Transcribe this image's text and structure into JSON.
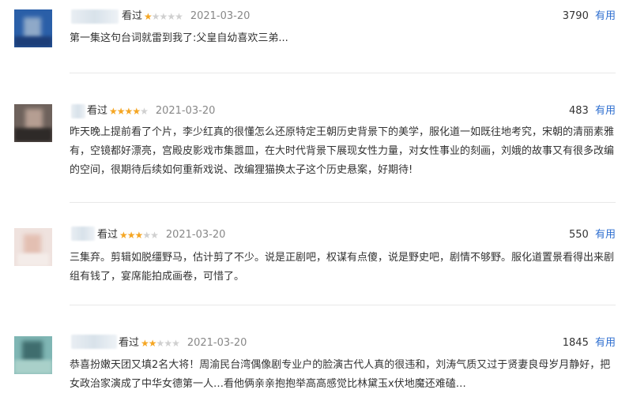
{
  "reviews": [
    {
      "watched": "看过",
      "rating": 1,
      "date": "2021-03-20",
      "votes": "3790",
      "useful": "有用",
      "content": "第一集这句台词就雷到我了:父皇自幼喜欢三弟..."
    },
    {
      "watched": "看过",
      "rating": 4,
      "date": "2021-03-20",
      "votes": "483",
      "useful": "有用",
      "content": "昨天晚上提前看了个片，李少红真的很懂怎么还原特定王朝历史背景下的美学，服化道一如既往地考究，宋朝的清丽素雅有，空镜都好漂亮，宫殿皮影戏市集嚣皿，在大时代背景下展现女性力量，对女性事业的刻画，刘娥的故事又有很多改编的空间，很期待后续如何重新戏说、改编狸猫换太子这个历史悬案，好期待!"
    },
    {
      "watched": "看过",
      "rating": 3,
      "date": "2021-03-20",
      "votes": "550",
      "useful": "有用",
      "content": "三集弃。剪辑如脱缰野马，估计剪了不少。说是正剧吧，权谋有点傻，说是野史吧，剧情不够野。服化道置景看得出来剧组有钱了，宴席能拍成画卷，可惜了。"
    },
    {
      "watched": "看过",
      "rating": 2,
      "date": "2021-03-20",
      "votes": "1845",
      "useful": "有用",
      "content": "恭喜扮嫩天团又填2名大将！周渝民台湾偶像剧专业户的脸演古代人真的很违和，刘涛气质又过于贤妻良母岁月静好，把女政治家演成了中华女德第一人…看他俩亲亲抱抱举高高感觉比林黛玉x伏地魔还难磕…"
    }
  ],
  "colors": {
    "star_on": "#f5a623",
    "star_off": "#d0d0d0",
    "useful_link": "#2f6fd0",
    "date": "#888888"
  }
}
